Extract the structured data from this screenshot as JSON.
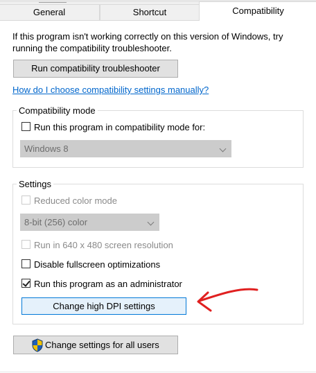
{
  "tabs": {
    "general": "General",
    "shortcut": "Shortcut",
    "compatibility": "Compatibility"
  },
  "intro_text": "If this program isn't working correctly on this version of Windows, try running the compatibility troubleshooter.",
  "troubleshooter_button": "Run compatibility troubleshooter",
  "manual_link": "How do I choose compatibility settings manually?",
  "compat_mode": {
    "group_label": "Compatibility mode",
    "checkbox_label": "Run this program in compatibility mode for:",
    "checked": false,
    "selected_os": "Windows 8"
  },
  "settings": {
    "group_label": "Settings",
    "reduced_color": {
      "label": "Reduced color mode",
      "checked": false,
      "enabled": false
    },
    "color_depth": "8-bit (256) color",
    "res_640": {
      "label": "Run in 640 x 480 screen resolution",
      "checked": false,
      "enabled": false
    },
    "fullscreen_opt": {
      "label": "Disable fullscreen optimizations",
      "checked": false,
      "enabled": true
    },
    "run_admin": {
      "label": "Run this program as an administrator",
      "checked": true,
      "enabled": true
    },
    "dpi_button": "Change high DPI settings"
  },
  "all_users_button": "Change settings for all users",
  "icons": {
    "shield": "uac-shield-icon",
    "annotation": "red-arrow-annotation"
  },
  "colors": {
    "link": "#0066cc",
    "focus_border": "#0078d7",
    "annotation_red": "#e02020"
  }
}
